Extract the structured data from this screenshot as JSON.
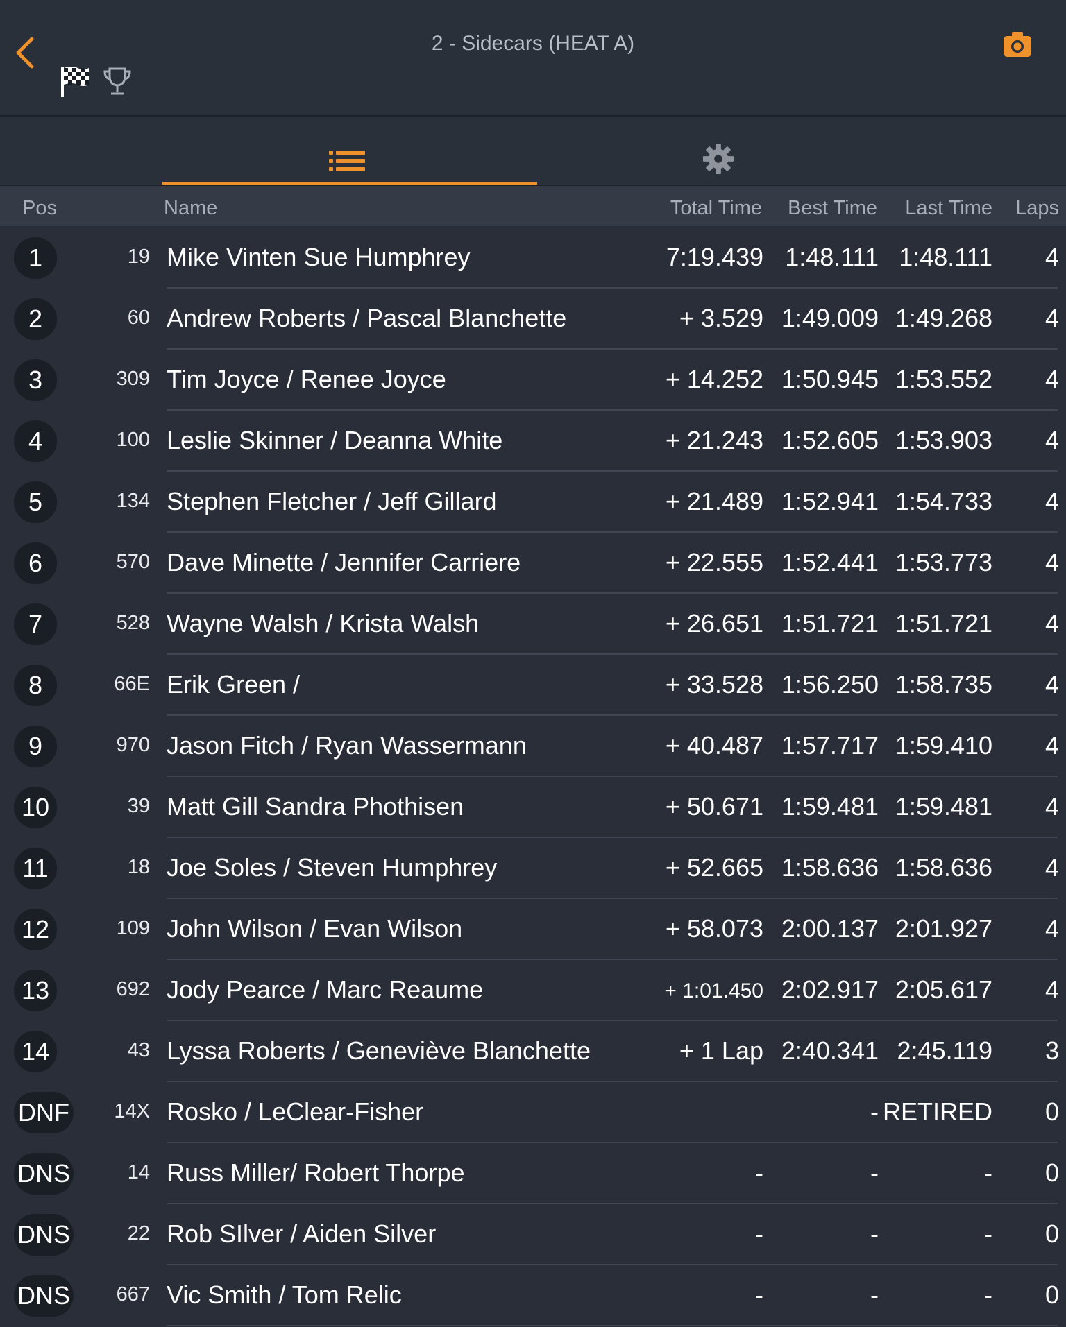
{
  "header": {
    "title": "2 - Sidecars (HEAT A)",
    "accent_color": "#f0922b",
    "icons": [
      "chevron-left-icon",
      "checkered-flag-icon",
      "trophy-icon",
      "camera-icon"
    ]
  },
  "tabs": [
    {
      "name": "results-list",
      "icon": "list-icon",
      "active": true
    },
    {
      "name": "settings",
      "icon": "gear-icon",
      "active": false
    }
  ],
  "columns": {
    "pos": "Pos",
    "name": "Name",
    "total": "Total Time",
    "best": "Best Time",
    "last": "Last Time",
    "laps": "Laps"
  },
  "rows": [
    {
      "pos": "1",
      "num": "19",
      "name": "Mike Vinten Sue Humphrey",
      "total": "7:19.439",
      "best": "1:48.111",
      "last": "1:48.111",
      "laps": "4"
    },
    {
      "pos": "2",
      "num": "60",
      "name": "Andrew Roberts /  Pascal Blanchette",
      "total": "+ 3.529",
      "best": "1:49.009",
      "last": "1:49.268",
      "laps": "4"
    },
    {
      "pos": "3",
      "num": "309",
      "name": "Tim Joyce /  Renee Joyce",
      "total": "+ 14.252",
      "best": "1:50.945",
      "last": "1:53.552",
      "laps": "4"
    },
    {
      "pos": "4",
      "num": "100",
      "name": "Leslie Skinner /  Deanna White",
      "total": "+ 21.243",
      "best": "1:52.605",
      "last": "1:53.903",
      "laps": "4"
    },
    {
      "pos": "5",
      "num": "134",
      "name": "Stephen Fletcher /  Jeff Gillard",
      "total": "+ 21.489",
      "best": "1:52.941",
      "last": "1:54.733",
      "laps": "4"
    },
    {
      "pos": "6",
      "num": "570",
      "name": "Dave Minette /  Jennifer Carriere",
      "total": "+ 22.555",
      "best": "1:52.441",
      "last": "1:53.773",
      "laps": "4"
    },
    {
      "pos": "7",
      "num": "528",
      "name": "Wayne Walsh /  Krista Walsh",
      "total": "+ 26.651",
      "best": "1:51.721",
      "last": "1:51.721",
      "laps": "4"
    },
    {
      "pos": "8",
      "num": "66E",
      "name": "Erik Green /",
      "total": "+ 33.528",
      "best": "1:56.250",
      "last": "1:58.735",
      "laps": "4"
    },
    {
      "pos": "9",
      "num": "970",
      "name": "Jason Fitch / Ryan Wassermann",
      "total": "+ 40.487",
      "best": "1:57.717",
      "last": "1:59.410",
      "laps": "4"
    },
    {
      "pos": "10",
      "num": "39",
      "name": "Matt Gill Sandra Phothisen",
      "total": "+ 50.671",
      "best": "1:59.481",
      "last": "1:59.481",
      "laps": "4"
    },
    {
      "pos": "11",
      "num": "18",
      "name": "Joe Soles /  Steven Humphrey",
      "total": "+ 52.665",
      "best": "1:58.636",
      "last": "1:58.636",
      "laps": "4"
    },
    {
      "pos": "12",
      "num": "109",
      "name": "John Wilson /  Evan Wilson",
      "total": "+ 58.073",
      "best": "2:00.137",
      "last": "2:01.927",
      "laps": "4"
    },
    {
      "pos": "13",
      "num": "692",
      "name": "Jody Pearce /  Marc Reaume",
      "total": "+ 1:01.450",
      "best": "2:02.917",
      "last": "2:05.617",
      "laps": "4"
    },
    {
      "pos": "14",
      "num": "43",
      "name": "Lyssa Roberts /  Geneviève Blanchette",
      "total": "+ 1 Lap",
      "best": "2:40.341",
      "last": "2:45.119",
      "laps": "3"
    },
    {
      "pos": "DNF",
      "num": "14X",
      "name": "Rosko / LeClear-Fisher",
      "total": "",
      "best": "-",
      "last": "RETIRED",
      "laps": "0"
    },
    {
      "pos": "DNS",
      "num": "14",
      "name": "Russ Miller/ Robert Thorpe",
      "total": "-",
      "best": "-",
      "last": "-",
      "laps": "0"
    },
    {
      "pos": "DNS",
      "num": "22",
      "name": "Rob SIlver /  Aiden Silver",
      "total": "-",
      "best": "-",
      "last": "-",
      "laps": "0"
    },
    {
      "pos": "DNS",
      "num": "667",
      "name": "Vic Smith /  Tom Relic",
      "total": "-",
      "best": "-",
      "last": "-",
      "laps": "0"
    }
  ]
}
